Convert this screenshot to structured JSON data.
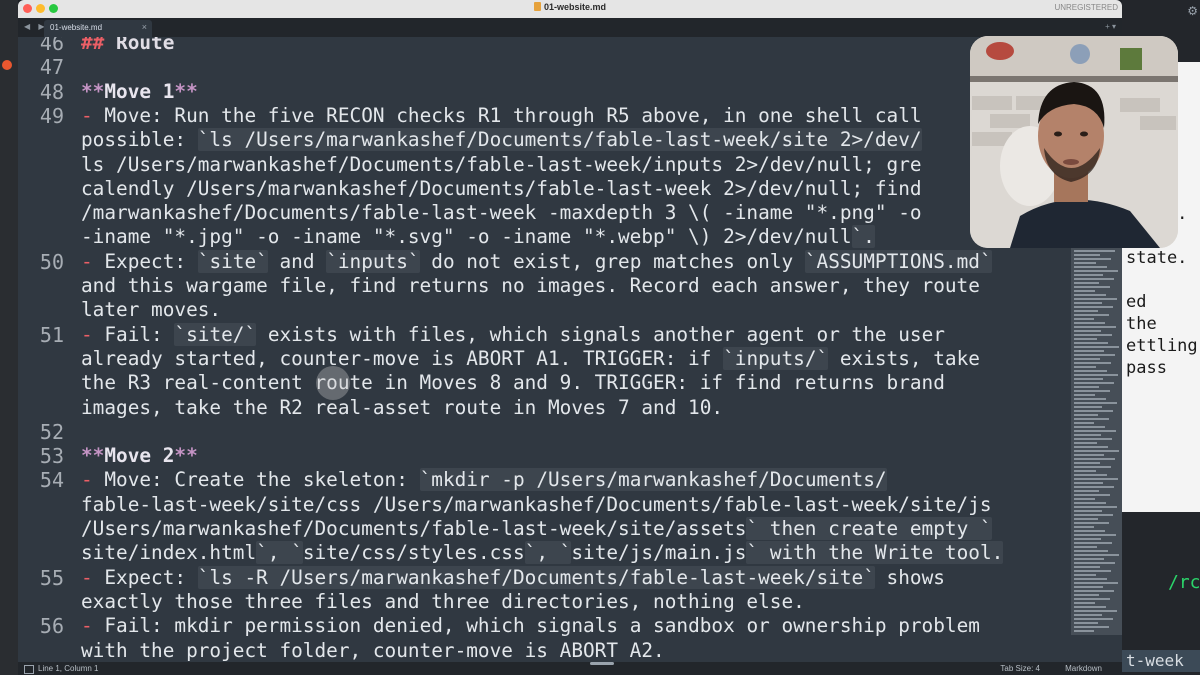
{
  "window": {
    "title": "01-website.md",
    "registration": "UNREGISTERED",
    "tab_label": "01-website.md",
    "tab_close": "×",
    "tab_arrows": "◀ ▶",
    "tab_tools": "+ ▾"
  },
  "editor": {
    "lines": [
      {
        "num": "46",
        "text": "## Route"
      },
      {
        "num": "47",
        "text": ""
      },
      {
        "num": "48",
        "text": "**Move 1**"
      },
      {
        "num": "49",
        "text": "- Move: Run the five RECON checks R1 through R5 above, in one shell call"
      },
      {
        "num": "",
        "text": "possible: `ls /Users/marwankashef/Documents/fable-last-week/site 2>/dev/"
      },
      {
        "num": "",
        "text": "ls /Users/marwankashef/Documents/fable-last-week/inputs 2>/dev/null; gre"
      },
      {
        "num": "",
        "text": "calendly /Users/marwankashef/Documents/fable-last-week 2>/dev/null; find"
      },
      {
        "num": "",
        "text": "/marwankashef/Documents/fable-last-week -maxdepth 3 \\( -iname \"*.png\" -o"
      },
      {
        "num": "",
        "text": "-iname \"*.jpg\" -o -iname \"*.svg\" -o -iname \"*.webp\" \\) 2>/dev/null`."
      },
      {
        "num": "50",
        "text": "- Expect: `site` and `inputs` do not exist, grep matches only `ASSUMPTIONS.md`"
      },
      {
        "num": "",
        "text": "and this wargame file, find returns no images. Record each answer, they route"
      },
      {
        "num": "",
        "text": "later moves."
      },
      {
        "num": "51",
        "text": "- Fail: `site/` exists with files, which signals another agent or the user"
      },
      {
        "num": "",
        "text": "already started, counter-move is ABORT A1. TRIGGER: if `inputs/` exists, take"
      },
      {
        "num": "",
        "text": "the R3 real-content route in Moves 8 and 9. TRIGGER: if find returns brand"
      },
      {
        "num": "",
        "text": "images, take the R2 real-asset route in Moves 7 and 10."
      },
      {
        "num": "52",
        "text": ""
      },
      {
        "num": "53",
        "text": "**Move 2**"
      },
      {
        "num": "54",
        "text": "- Move: Create the skeleton: `mkdir -p /Users/marwankashef/Documents/"
      },
      {
        "num": "",
        "text": "fable-last-week/site/css /Users/marwankashef/Documents/fable-last-week/site/js"
      },
      {
        "num": "",
        "text": "/Users/marwankashef/Documents/fable-last-week/site/assets` then create empty `"
      },
      {
        "num": "",
        "text": "site/index.html`, `site/css/styles.css`, `site/js/main.js` with the Write tool."
      },
      {
        "num": "55",
        "text": "- Expect: `ls -R /Users/marwankashef/Documents/fable-last-week/site` shows"
      },
      {
        "num": "",
        "text": "exactly those three files and three directories, nothing else."
      },
      {
        "num": "56",
        "text": "- Fail: mkdir permission denied, which signals a sandbox or ownership problem"
      },
      {
        "num": "",
        "text": "with the project folder, counter-move is ABORT A2."
      }
    ]
  },
  "status_bar": {
    "position": "Line 1, Column 1",
    "tab_size": "Tab Size: 4",
    "syntax": "Markdown"
  },
  "background_app": {
    "peek_lines": [
      "h",
      "t",
      "",
      "",
      "",
      "",
      "he it.",
      "",
      "state.",
      "",
      "ed",
      "the",
      "ettling",
      "pass"
    ],
    "path_fragment": "/rc",
    "branch_fragment": "t-week"
  },
  "colors": {
    "editor_bg": "#303841",
    "heading": "#ec5f66",
    "bold_marker": "#c594c5",
    "inline_code_bg": "#3d454e",
    "text": "#e3e7eb"
  }
}
